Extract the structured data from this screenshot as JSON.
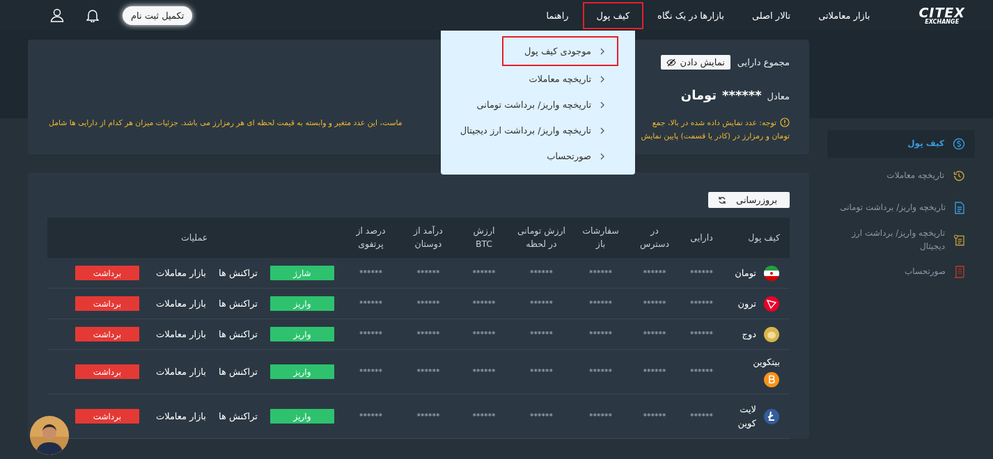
{
  "logo": {
    "line_1": "CITEX",
    "line_2": "EXCHANGE"
  },
  "nav": [
    {
      "label": "بازار معاملاتی",
      "highlighted": false
    },
    {
      "label": "تالار اصلی",
      "highlighted": false
    },
    {
      "label": "بازارها در یک نگاه",
      "highlighted": false
    },
    {
      "label": "کیف پول",
      "highlighted": true
    },
    {
      "label": "راهنما",
      "highlighted": false
    }
  ],
  "register_button": "تکمیل ثبت نام",
  "nav_menu": [
    {
      "label": "موجودی کیف پول",
      "highlighted": true
    },
    {
      "label": "تاریخچه معاملات",
      "highlighted": false
    },
    {
      "label": "تاریخچه واریز/ برداشت تومانی",
      "highlighted": false
    },
    {
      "label": "تاریخچه واریز/ برداشت ارز دیجیتال",
      "highlighted": false
    },
    {
      "label": "صورتحساب",
      "highlighted": false
    }
  ],
  "summary": {
    "total_label": "مجموع دارایی",
    "show_button": "نمایش دادن",
    "equivalent_label": "معادل",
    "amount": "******",
    "currency": "تومان",
    "notice_lines": [
      {
        "right": "توجه: عدد نمایش داده شده در بالا، جمع",
        "left": "ماست، این عدد متغیر و وابسته به قیمت لحظه ای هر رمزارز می باشد. جزئیات میزان هر کدام از دارایی ها شامل"
      },
      {
        "right": "تومان و رمزارز در (کادر یا قسمت) پایین نمایش"
      }
    ]
  },
  "sidebar": [
    {
      "label": "کیف پول",
      "selected": true,
      "kind": "wallet"
    },
    {
      "label": "تاریخچه معاملات",
      "selected": false,
      "kind": "history"
    },
    {
      "label": "تاریخچه واریز/ برداشت تومانی",
      "selected": false,
      "kind": "toman"
    },
    {
      "label": "تاریخچه واریز/ برداشت ارز دیجیتال",
      "selected": false,
      "kind": "crypto"
    },
    {
      "label": "صورتحساب",
      "selected": false,
      "kind": "statement"
    }
  ],
  "refresh_button": "بروزرسانی",
  "table": {
    "columns": [
      "کیف پول",
      "دارایی",
      "در\nدسترس",
      "سفارشات\nباز",
      "ارزش تومانی\nدر لحظه",
      "ارزش\nBTC",
      "درآمد از\nدوستان",
      "درصد از\nپرتفوی",
      "عملیات"
    ],
    "rows": [
      {
        "kind": "toman",
        "name": "تومان",
        "values": [
          "******",
          "******",
          "******",
          "******",
          "******",
          "******",
          "******"
        ],
        "deposit": "شارژ",
        "transactions": "تراکنش ها",
        "market": "بازار معاملات",
        "withdraw": "برداشت"
      },
      {
        "kind": "tron",
        "name": "ترون",
        "values": [
          "******",
          "******",
          "******",
          "******",
          "******",
          "******",
          "******"
        ],
        "deposit": "واریز",
        "transactions": "تراکنش ها",
        "market": "بازار معاملات",
        "withdraw": "برداشت"
      },
      {
        "kind": "doge",
        "name": "دوج",
        "values": [
          "******",
          "******",
          "******",
          "******",
          "******",
          "******",
          "******"
        ],
        "deposit": "واریز",
        "transactions": "تراکنش ها",
        "market": "بازار معاملات",
        "withdraw": "برداشت"
      },
      {
        "kind": "bitcoin",
        "name": "بیتکوین",
        "values": [
          "******",
          "******",
          "******",
          "******",
          "******",
          "******",
          "******"
        ],
        "deposit": "واریز",
        "transactions": "تراکنش ها",
        "market": "بازار معاملات",
        "withdraw": "برداشت"
      },
      {
        "kind": "litecoin",
        "name": "لایت\nکوین",
        "values": [
          "******",
          "******",
          "******",
          "******",
          "******",
          "******",
          "******"
        ],
        "deposit": "واریز",
        "transactions": "تراکنش ها",
        "market": "بازار معاملات",
        "withdraw": "برداشت"
      }
    ]
  }
}
